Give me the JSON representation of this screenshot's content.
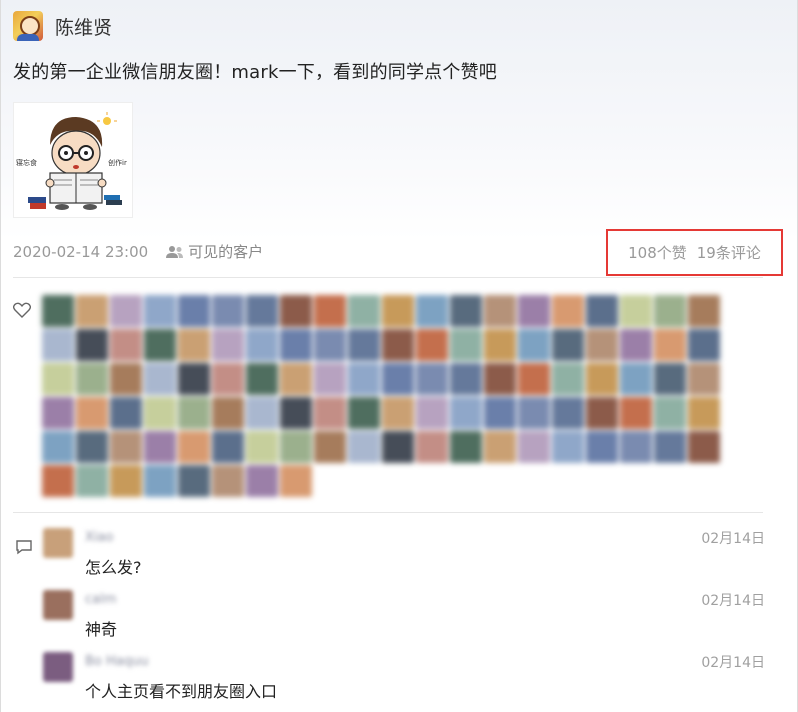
{
  "post": {
    "author": "陈维贤",
    "text": "发的第一企业微信朋友圈！mark一下，看到的同学点个赞吧",
    "image": {
      "left_text": "寝忘食",
      "right_text": "创作ir"
    },
    "timestamp": "2020-02-14 23:00",
    "visibility": "可见的客户",
    "likes_count": "108个赞",
    "comments_count": "19条评论"
  },
  "likers_count": 108,
  "like_avatar_colors": [
    "#5b6f8c",
    "#8fa7c9",
    "#b59279",
    "#4f6e5f",
    "#c79a5a",
    "#a9b7cf",
    "#8c5b4a",
    "#c6cf9c",
    "#6a7faa",
    "#9b7fa8",
    "#caa073",
    "#7da2c2",
    "#464d58",
    "#c46f4d",
    "#9bb08d",
    "#7a8bb0",
    "#d89a70",
    "#b7a2c0",
    "#586b7e",
    "#c38e86",
    "#8fb1a4",
    "#a67c5c",
    "#65799b"
  ],
  "comments": [
    {
      "name": "Xiao",
      "date": "02月14日",
      "text": "怎么发?",
      "avatar_color": "#c8a07a"
    },
    {
      "name": "calm",
      "date": "02月14日",
      "text": "神奇",
      "avatar_color": "#9a6f5e"
    },
    {
      "name": "Bo Haquu",
      "date": "02月14日",
      "text": "个人主页看不到朋友圈入口",
      "avatar_color": "#7b5d80"
    }
  ]
}
